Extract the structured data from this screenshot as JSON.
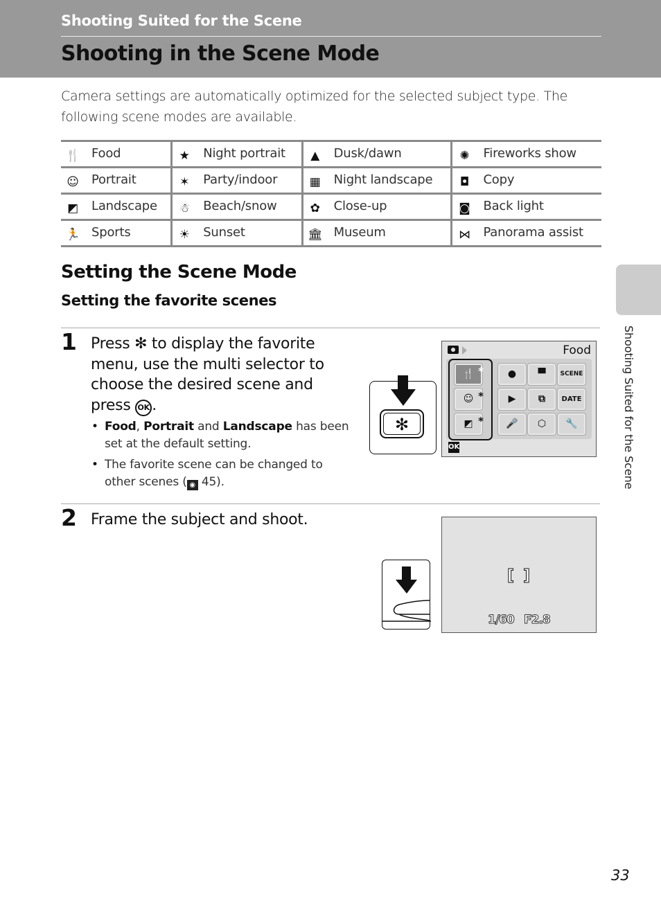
{
  "header": {
    "section_title": "Shooting Suited for the Scene",
    "page_title": "Shooting in the Scene Mode"
  },
  "intro": "Camera settings are automatically optimized for the selected subject type. The following scene modes are available.",
  "scene_modes": [
    [
      {
        "icon": "food-icon",
        "glyph": "🍴",
        "label": "Food"
      },
      {
        "icon": "night-portrait-icon",
        "glyph": "★",
        "label": "Night portrait"
      },
      {
        "icon": "dusk-dawn-icon",
        "glyph": "▲",
        "label": "Dusk/dawn"
      },
      {
        "icon": "fireworks-show-icon",
        "glyph": "✺",
        "label": "Fireworks show"
      }
    ],
    [
      {
        "icon": "portrait-icon",
        "glyph": "☺",
        "label": "Portrait"
      },
      {
        "icon": "party-indoor-icon",
        "glyph": "✶",
        "label": "Party/indoor"
      },
      {
        "icon": "night-landscape-icon",
        "glyph": "▦",
        "label": "Night landscape"
      },
      {
        "icon": "copy-icon",
        "glyph": "◘",
        "label": "Copy"
      }
    ],
    [
      {
        "icon": "landscape-icon",
        "glyph": "◩",
        "label": "Landscape"
      },
      {
        "icon": "beach-snow-icon",
        "glyph": "☃",
        "label": "Beach/snow"
      },
      {
        "icon": "close-up-icon",
        "glyph": "✿",
        "label": "Close-up"
      },
      {
        "icon": "back-light-icon",
        "glyph": "◙",
        "label": "Back light"
      }
    ],
    [
      {
        "icon": "sports-icon",
        "glyph": "🏃",
        "label": "Sports"
      },
      {
        "icon": "sunset-icon",
        "glyph": "☀",
        "label": "Sunset"
      },
      {
        "icon": "museum-icon",
        "glyph": "🏛",
        "label": "Museum"
      },
      {
        "icon": "panorama-assist-icon",
        "glyph": "⋈",
        "label": "Panorama assist"
      }
    ]
  ],
  "section": {
    "heading": "Setting the Scene Mode",
    "subheading": "Setting the favorite scenes"
  },
  "steps": [
    {
      "number": "1",
      "text_before": "Press ",
      "star_glyph": "✻",
      "text_mid": " to display the favorite menu, use the multi selector to choose the desired scene and press ",
      "ok_label": "OK",
      "text_end": ".",
      "bullets": [
        {
          "b1": "Food",
          "s1": ", ",
          "b2": "Portrait",
          "s2": " and ",
          "b3": "Landscape",
          "s3": " has been set at the default setting."
        },
        {
          "text": "The favorite scene can be changed to other scenes (",
          "ref_page": "45",
          "text_end": ")."
        }
      ]
    },
    {
      "number": "2",
      "text": "Frame the subject and shoot."
    }
  ],
  "camera_screen_1": {
    "selected_label": "Food",
    "ok_tag": "OK",
    "tiles": [
      "🍴",
      "☺",
      "◩",
      "●",
      "▶",
      "🎤",
      "▀",
      "⧉",
      "⬡",
      "SCENE",
      "DATE",
      "🔧"
    ],
    "asterisk": "*"
  },
  "camera_screen_2": {
    "shutter_speed": "1/60",
    "aperture": "F2.8",
    "focus_bracket_left": "[",
    "focus_bracket_right": "]"
  },
  "side_tab_label": "Shooting Suited for the Scene",
  "page_number": "33",
  "button_star": "✻"
}
